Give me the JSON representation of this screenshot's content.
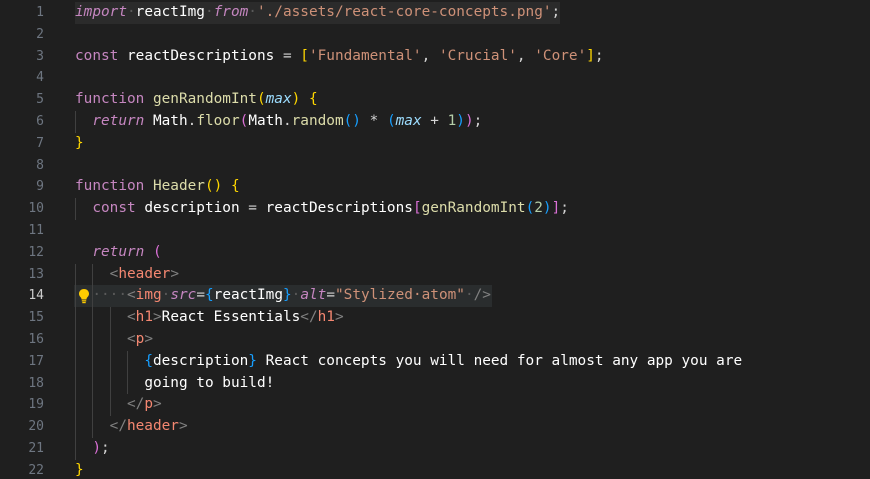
{
  "lines": [
    {
      "n": "1",
      "tokens": [
        [
          "kw-i",
          "import"
        ],
        [
          "ws",
          "·"
        ],
        [
          "id",
          "reactImg"
        ],
        [
          "ws",
          "·"
        ],
        [
          "kw-i",
          "from"
        ],
        [
          "ws",
          "·"
        ],
        [
          "str",
          "'./assets/react-core-concepts.png'"
        ],
        [
          "op",
          ";"
        ]
      ]
    },
    {
      "n": "2",
      "tokens": []
    },
    {
      "n": "3",
      "tokens": [
        [
          "kw",
          "const"
        ],
        [
          "op",
          " "
        ],
        [
          "id",
          "reactDescriptions"
        ],
        [
          "op",
          " = "
        ],
        [
          "br1",
          "["
        ],
        [
          "str",
          "'Fundamental'"
        ],
        [
          "op",
          ", "
        ],
        [
          "str",
          "'Crucial'"
        ],
        [
          "op",
          ", "
        ],
        [
          "str",
          "'Core'"
        ],
        [
          "br1",
          "]"
        ],
        [
          "op",
          ";"
        ]
      ]
    },
    {
      "n": "4",
      "tokens": []
    },
    {
      "n": "5",
      "tokens": [
        [
          "kw",
          "function"
        ],
        [
          "op",
          " "
        ],
        [
          "fn",
          "genRandomInt"
        ],
        [
          "br1",
          "("
        ],
        [
          "par",
          "max"
        ],
        [
          "br1",
          ")"
        ],
        [
          "op",
          " "
        ],
        [
          "br1",
          "{"
        ]
      ]
    },
    {
      "n": "6",
      "tokens": [
        [
          "op",
          "  "
        ],
        [
          "kw-i",
          "return"
        ],
        [
          "op",
          " "
        ],
        [
          "id",
          "Math"
        ],
        [
          "op",
          "."
        ],
        [
          "fn",
          "floor"
        ],
        [
          "br2",
          "("
        ],
        [
          "id",
          "Math"
        ],
        [
          "op",
          "."
        ],
        [
          "fn",
          "random"
        ],
        [
          "br3",
          "()"
        ],
        [
          "op",
          " * "
        ],
        [
          "br3",
          "("
        ],
        [
          "par",
          "max"
        ],
        [
          "op",
          " + "
        ],
        [
          "num",
          "1"
        ],
        [
          "br3",
          ")"
        ],
        [
          "br2",
          ")"
        ],
        [
          "op",
          ";"
        ]
      ]
    },
    {
      "n": "7",
      "tokens": [
        [
          "br1",
          "}"
        ]
      ]
    },
    {
      "n": "8",
      "tokens": []
    },
    {
      "n": "9",
      "tokens": [
        [
          "kw",
          "function"
        ],
        [
          "op",
          " "
        ],
        [
          "fn",
          "Header"
        ],
        [
          "br1",
          "()"
        ],
        [
          "op",
          " "
        ],
        [
          "br1",
          "{"
        ]
      ]
    },
    {
      "n": "10",
      "tokens": [
        [
          "op",
          "  "
        ],
        [
          "kw",
          "const"
        ],
        [
          "op",
          " "
        ],
        [
          "id",
          "description"
        ],
        [
          "op",
          " = "
        ],
        [
          "id",
          "reactDescriptions"
        ],
        [
          "br2",
          "["
        ],
        [
          "fn",
          "genRandomInt"
        ],
        [
          "br3",
          "("
        ],
        [
          "num",
          "2"
        ],
        [
          "br3",
          ")"
        ],
        [
          "br2",
          "]"
        ],
        [
          "op",
          ";"
        ]
      ]
    },
    {
      "n": "11",
      "tokens": []
    },
    {
      "n": "12",
      "tokens": [
        [
          "op",
          "  "
        ],
        [
          "kw-i",
          "return"
        ],
        [
          "op",
          " "
        ],
        [
          "br2",
          "("
        ]
      ]
    },
    {
      "n": "13",
      "tokens": [
        [
          "op",
          "    "
        ],
        [
          "ang",
          "<"
        ],
        [
          "tag",
          "header"
        ],
        [
          "ang",
          ">"
        ]
      ]
    },
    {
      "n": "14",
      "tokens": [
        [
          "op",
          "  "
        ],
        [
          "ws",
          "····"
        ],
        [
          "ang",
          "<"
        ],
        [
          "tag",
          "img"
        ],
        [
          "ws",
          "·"
        ],
        [
          "attr",
          "src"
        ],
        [
          "op",
          "="
        ],
        [
          "br3",
          "{"
        ],
        [
          "jsx",
          "reactImg"
        ],
        [
          "br3",
          "}"
        ],
        [
          "ws",
          "·"
        ],
        [
          "attr",
          "alt"
        ],
        [
          "op",
          "="
        ],
        [
          "str",
          "\"Stylized·atom\""
        ],
        [
          "ws",
          "·"
        ],
        [
          "ang",
          "/>"
        ]
      ]
    },
    {
      "n": "15",
      "tokens": [
        [
          "op",
          "      "
        ],
        [
          "ang",
          "<"
        ],
        [
          "tag",
          "h1"
        ],
        [
          "ang",
          ">"
        ],
        [
          "jsx",
          "React Essentials"
        ],
        [
          "ang",
          "</"
        ],
        [
          "tag",
          "h1"
        ],
        [
          "ang",
          ">"
        ]
      ]
    },
    {
      "n": "16",
      "tokens": [
        [
          "op",
          "      "
        ],
        [
          "ang",
          "<"
        ],
        [
          "tag",
          "p"
        ],
        [
          "ang",
          ">"
        ]
      ]
    },
    {
      "n": "17",
      "tokens": [
        [
          "op",
          "        "
        ],
        [
          "br3",
          "{"
        ],
        [
          "jsx",
          "description"
        ],
        [
          "br3",
          "}"
        ],
        [
          "jsx",
          " React concepts you will need for almost any app you are"
        ]
      ]
    },
    {
      "n": "18",
      "tokens": [
        [
          "op",
          "        "
        ],
        [
          "jsx",
          "going to build!"
        ]
      ]
    },
    {
      "n": "19",
      "tokens": [
        [
          "op",
          "      "
        ],
        [
          "ang",
          "</"
        ],
        [
          "tag",
          "p"
        ],
        [
          "ang",
          ">"
        ]
      ]
    },
    {
      "n": "20",
      "tokens": [
        [
          "op",
          "    "
        ],
        [
          "ang",
          "</"
        ],
        [
          "tag",
          "header"
        ],
        [
          "ang",
          ">"
        ]
      ]
    },
    {
      "n": "21",
      "tokens": [
        [
          "op",
          "  "
        ],
        [
          "br2",
          ")"
        ],
        [
          "op",
          ";"
        ]
      ]
    },
    {
      "n": "22",
      "tokens": [
        [
          "br1",
          "}"
        ]
      ]
    }
  ],
  "current_line": "14",
  "lightbulb_icon": "lightbulb-icon"
}
